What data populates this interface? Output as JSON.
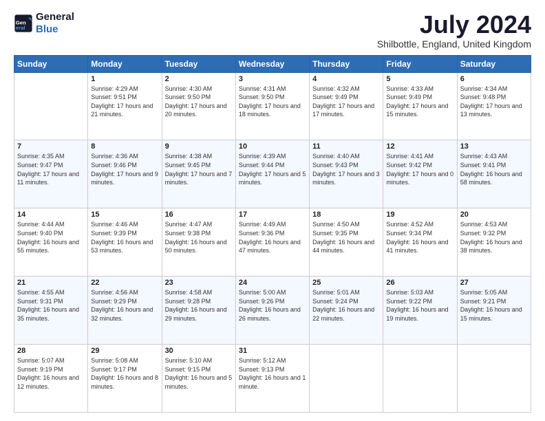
{
  "logo": {
    "line1": "General",
    "line2": "Blue"
  },
  "title": "July 2024",
  "subtitle": "Shilbottle, England, United Kingdom",
  "columns": [
    "Sunday",
    "Monday",
    "Tuesday",
    "Wednesday",
    "Thursday",
    "Friday",
    "Saturday"
  ],
  "weeks": [
    [
      {
        "day": "",
        "sunrise": "",
        "sunset": "",
        "daylight": ""
      },
      {
        "day": "1",
        "sunrise": "Sunrise: 4:29 AM",
        "sunset": "Sunset: 9:51 PM",
        "daylight": "Daylight: 17 hours and 21 minutes."
      },
      {
        "day": "2",
        "sunrise": "Sunrise: 4:30 AM",
        "sunset": "Sunset: 9:50 PM",
        "daylight": "Daylight: 17 hours and 20 minutes."
      },
      {
        "day": "3",
        "sunrise": "Sunrise: 4:31 AM",
        "sunset": "Sunset: 9:50 PM",
        "daylight": "Daylight: 17 hours and 18 minutes."
      },
      {
        "day": "4",
        "sunrise": "Sunrise: 4:32 AM",
        "sunset": "Sunset: 9:49 PM",
        "daylight": "Daylight: 17 hours and 17 minutes."
      },
      {
        "day": "5",
        "sunrise": "Sunrise: 4:33 AM",
        "sunset": "Sunset: 9:49 PM",
        "daylight": "Daylight: 17 hours and 15 minutes."
      },
      {
        "day": "6",
        "sunrise": "Sunrise: 4:34 AM",
        "sunset": "Sunset: 9:48 PM",
        "daylight": "Daylight: 17 hours and 13 minutes."
      }
    ],
    [
      {
        "day": "7",
        "sunrise": "Sunrise: 4:35 AM",
        "sunset": "Sunset: 9:47 PM",
        "daylight": "Daylight: 17 hours and 11 minutes."
      },
      {
        "day": "8",
        "sunrise": "Sunrise: 4:36 AM",
        "sunset": "Sunset: 9:46 PM",
        "daylight": "Daylight: 17 hours and 9 minutes."
      },
      {
        "day": "9",
        "sunrise": "Sunrise: 4:38 AM",
        "sunset": "Sunset: 9:45 PM",
        "daylight": "Daylight: 17 hours and 7 minutes."
      },
      {
        "day": "10",
        "sunrise": "Sunrise: 4:39 AM",
        "sunset": "Sunset: 9:44 PM",
        "daylight": "Daylight: 17 hours and 5 minutes."
      },
      {
        "day": "11",
        "sunrise": "Sunrise: 4:40 AM",
        "sunset": "Sunset: 9:43 PM",
        "daylight": "Daylight: 17 hours and 3 minutes."
      },
      {
        "day": "12",
        "sunrise": "Sunrise: 4:41 AM",
        "sunset": "Sunset: 9:42 PM",
        "daylight": "Daylight: 17 hours and 0 minutes."
      },
      {
        "day": "13",
        "sunrise": "Sunrise: 4:43 AM",
        "sunset": "Sunset: 9:41 PM",
        "daylight": "Daylight: 16 hours and 58 minutes."
      }
    ],
    [
      {
        "day": "14",
        "sunrise": "Sunrise: 4:44 AM",
        "sunset": "Sunset: 9:40 PM",
        "daylight": "Daylight: 16 hours and 55 minutes."
      },
      {
        "day": "15",
        "sunrise": "Sunrise: 4:46 AM",
        "sunset": "Sunset: 9:39 PM",
        "daylight": "Daylight: 16 hours and 53 minutes."
      },
      {
        "day": "16",
        "sunrise": "Sunrise: 4:47 AM",
        "sunset": "Sunset: 9:38 PM",
        "daylight": "Daylight: 16 hours and 50 minutes."
      },
      {
        "day": "17",
        "sunrise": "Sunrise: 4:49 AM",
        "sunset": "Sunset: 9:36 PM",
        "daylight": "Daylight: 16 hours and 47 minutes."
      },
      {
        "day": "18",
        "sunrise": "Sunrise: 4:50 AM",
        "sunset": "Sunset: 9:35 PM",
        "daylight": "Daylight: 16 hours and 44 minutes."
      },
      {
        "day": "19",
        "sunrise": "Sunrise: 4:52 AM",
        "sunset": "Sunset: 9:34 PM",
        "daylight": "Daylight: 16 hours and 41 minutes."
      },
      {
        "day": "20",
        "sunrise": "Sunrise: 4:53 AM",
        "sunset": "Sunset: 9:32 PM",
        "daylight": "Daylight: 16 hours and 38 minutes."
      }
    ],
    [
      {
        "day": "21",
        "sunrise": "Sunrise: 4:55 AM",
        "sunset": "Sunset: 9:31 PM",
        "daylight": "Daylight: 16 hours and 35 minutes."
      },
      {
        "day": "22",
        "sunrise": "Sunrise: 4:56 AM",
        "sunset": "Sunset: 9:29 PM",
        "daylight": "Daylight: 16 hours and 32 minutes."
      },
      {
        "day": "23",
        "sunrise": "Sunrise: 4:58 AM",
        "sunset": "Sunset: 9:28 PM",
        "daylight": "Daylight: 16 hours and 29 minutes."
      },
      {
        "day": "24",
        "sunrise": "Sunrise: 5:00 AM",
        "sunset": "Sunset: 9:26 PM",
        "daylight": "Daylight: 16 hours and 26 minutes."
      },
      {
        "day": "25",
        "sunrise": "Sunrise: 5:01 AM",
        "sunset": "Sunset: 9:24 PM",
        "daylight": "Daylight: 16 hours and 22 minutes."
      },
      {
        "day": "26",
        "sunrise": "Sunrise: 5:03 AM",
        "sunset": "Sunset: 9:22 PM",
        "daylight": "Daylight: 16 hours and 19 minutes."
      },
      {
        "day": "27",
        "sunrise": "Sunrise: 5:05 AM",
        "sunset": "Sunset: 9:21 PM",
        "daylight": "Daylight: 16 hours and 15 minutes."
      }
    ],
    [
      {
        "day": "28",
        "sunrise": "Sunrise: 5:07 AM",
        "sunset": "Sunset: 9:19 PM",
        "daylight": "Daylight: 16 hours and 12 minutes."
      },
      {
        "day": "29",
        "sunrise": "Sunrise: 5:08 AM",
        "sunset": "Sunset: 9:17 PM",
        "daylight": "Daylight: 16 hours and 8 minutes."
      },
      {
        "day": "30",
        "sunrise": "Sunrise: 5:10 AM",
        "sunset": "Sunset: 9:15 PM",
        "daylight": "Daylight: 16 hours and 5 minutes."
      },
      {
        "day": "31",
        "sunrise": "Sunrise: 5:12 AM",
        "sunset": "Sunset: 9:13 PM",
        "daylight": "Daylight: 16 hours and 1 minute."
      },
      {
        "day": "",
        "sunrise": "",
        "sunset": "",
        "daylight": ""
      },
      {
        "day": "",
        "sunrise": "",
        "sunset": "",
        "daylight": ""
      },
      {
        "day": "",
        "sunrise": "",
        "sunset": "",
        "daylight": ""
      }
    ]
  ]
}
